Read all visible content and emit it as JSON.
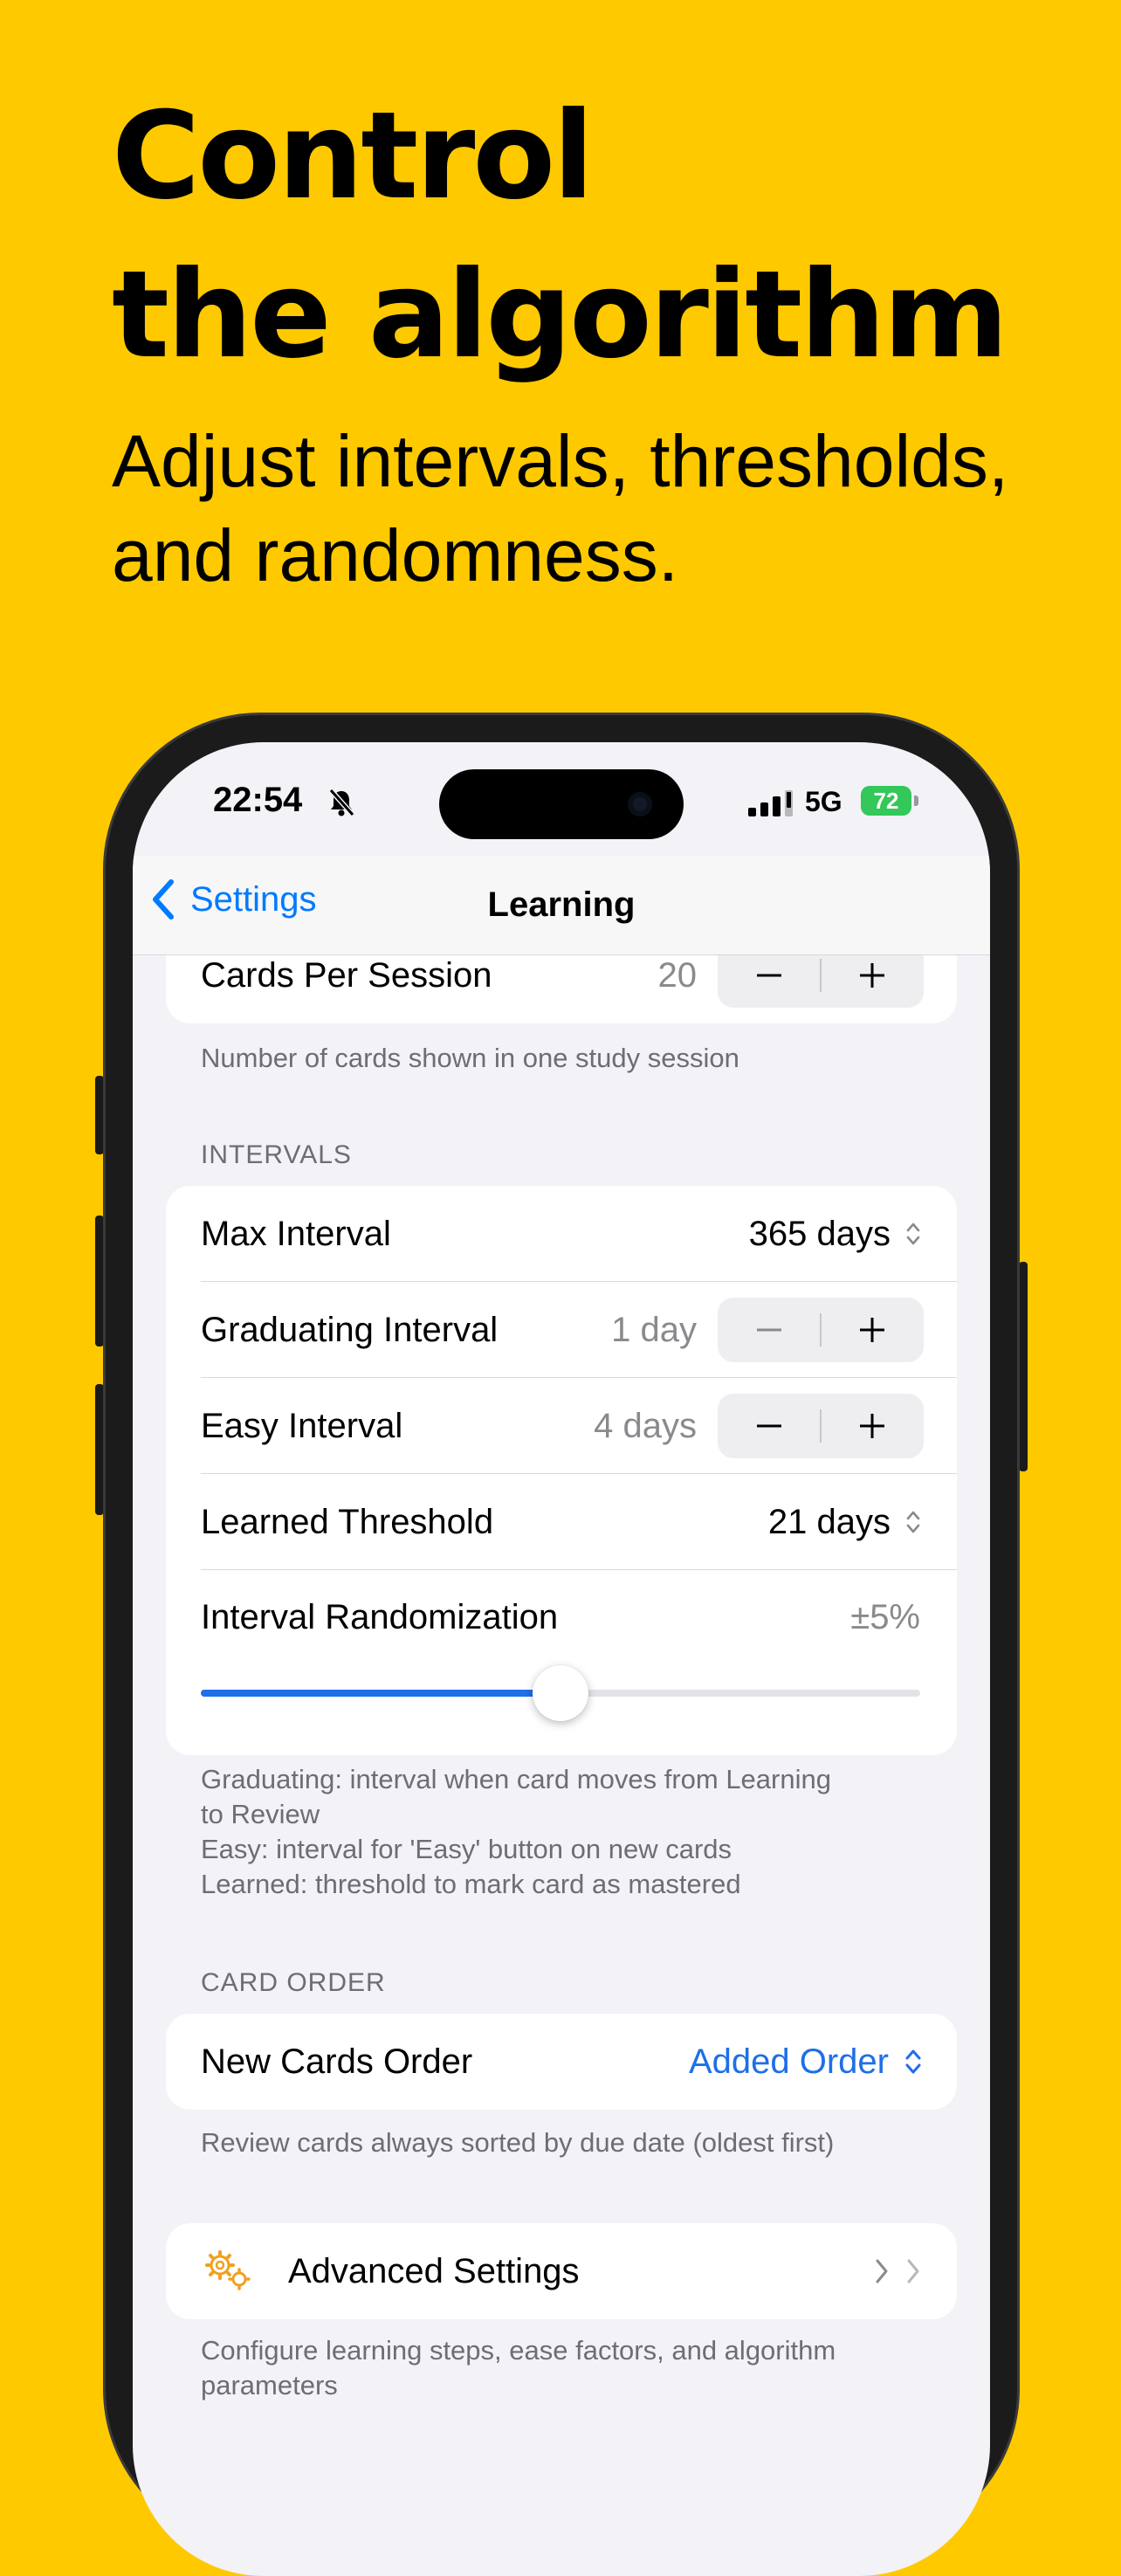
{
  "hero": {
    "headline_line1": "Control",
    "headline_line2": "the algorithm",
    "subtitle_line1": "Adjust intervals, thresholds,",
    "subtitle_line2": "and randomness."
  },
  "status_bar": {
    "time": "22:54",
    "network": "5G",
    "battery": "72"
  },
  "nav": {
    "back_label": "Settings",
    "title": "Learning"
  },
  "cards_per_session": {
    "label": "Cards Per Session",
    "value": "20",
    "footer": "Number of cards shown in one study session"
  },
  "intervals": {
    "header": "INTERVALS",
    "max_interval": {
      "label": "Max Interval",
      "value": "365 days"
    },
    "graduating_interval": {
      "label": "Graduating Interval",
      "value": "1 day"
    },
    "easy_interval": {
      "label": "Easy Interval",
      "value": "4 days"
    },
    "learned_threshold": {
      "label": "Learned Threshold",
      "value": "21 days"
    },
    "randomization": {
      "label": "Interval Randomization",
      "value": "±5%",
      "slider_fraction": 0.5
    },
    "footer_lines": [
      "Graduating: interval when card moves from Learning",
      "to Review",
      "Easy: interval for 'Easy' button on new cards",
      "Learned: threshold to mark card as mastered"
    ]
  },
  "card_order": {
    "header": "CARD ORDER",
    "new_cards_order": {
      "label": "New Cards Order",
      "value": "Added Order"
    },
    "footer": "Review cards always sorted by due date (oldest first)"
  },
  "advanced": {
    "label": "Advanced Settings",
    "footer_lines": [
      "Configure learning steps, ease factors, and algorithm",
      "parameters"
    ]
  },
  "colors": {
    "background": "#FFC900",
    "accent": "#007AFF",
    "slider_fill": "#1E6FE8",
    "battery": "#34C759",
    "gear_icon": "#F0A020"
  }
}
